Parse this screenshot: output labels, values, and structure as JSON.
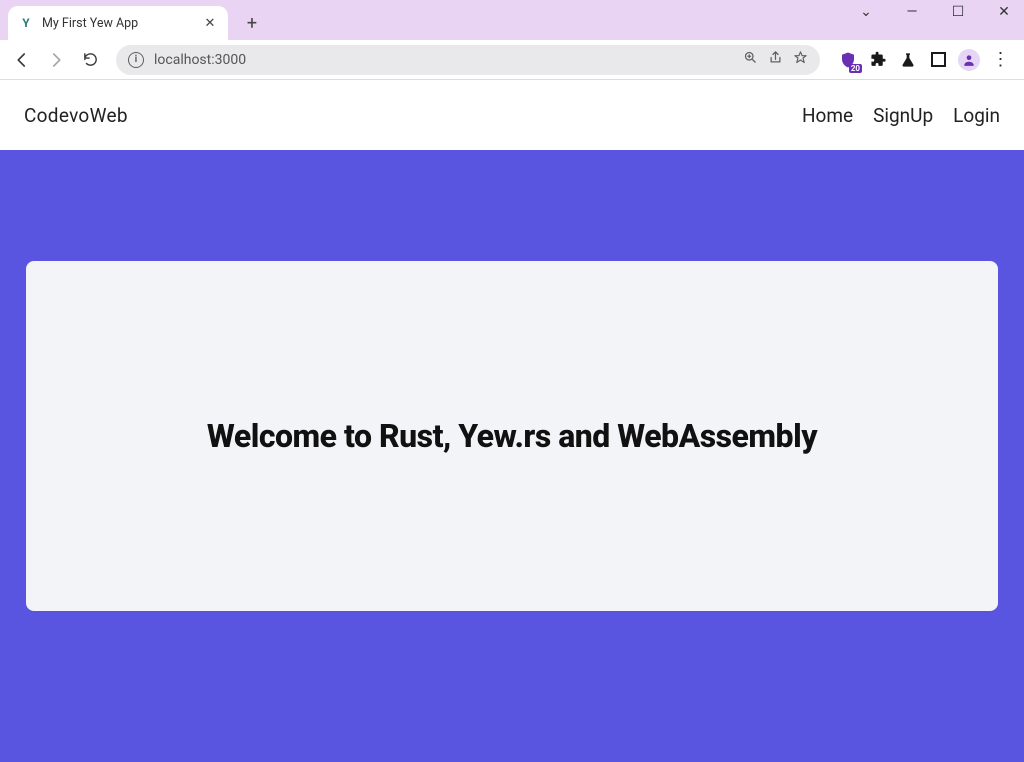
{
  "browser": {
    "tab_title": "My First Yew App",
    "url": "localhost:3000",
    "extension_badge": "20"
  },
  "site": {
    "brand": "CodevoWeb",
    "nav": {
      "home": "Home",
      "signup": "SignUp",
      "login": "Login"
    },
    "hero_heading": "Welcome to Rust, Yew.rs and WebAssembly"
  }
}
